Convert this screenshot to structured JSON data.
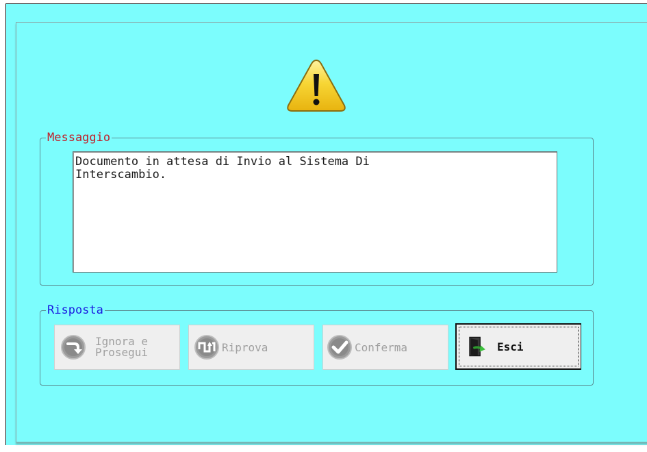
{
  "message_group": {
    "legend": "Messaggio",
    "text": "Documento in attesa di Invio al Sistema Di\nInterscambio."
  },
  "response_group": {
    "legend": "Risposta",
    "buttons": [
      {
        "label": "Ignora e\nProsegui",
        "icon": "arrow-turn-icon",
        "enabled": false
      },
      {
        "label": "Riprova",
        "icon": "retry-arrows-icon",
        "enabled": false
      },
      {
        "label": "Conferma",
        "icon": "checkmark-icon",
        "enabled": false
      },
      {
        "label": "Esci",
        "icon": "exit-door-icon",
        "enabled": true,
        "focused": true
      }
    ]
  },
  "icon": "warning-icon",
  "colors": {
    "dialog_background": "#7cfdfd",
    "message_legend": "#c0202a",
    "response_legend": "#1a1ae0",
    "warning_yellow": "#f5cc1d"
  }
}
